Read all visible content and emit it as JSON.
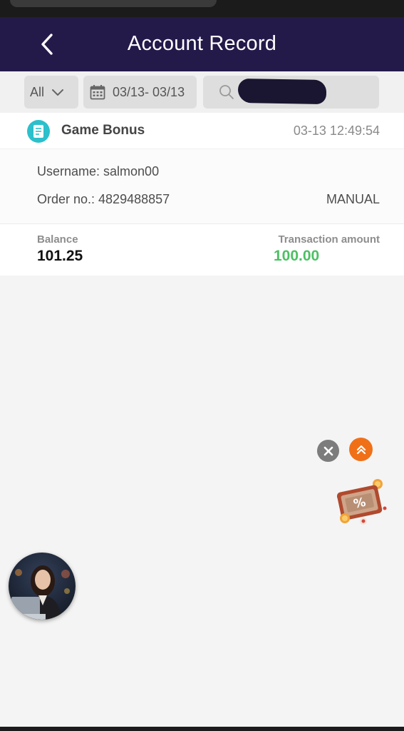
{
  "header": {
    "title": "Account Record",
    "back_icon": "chevron-left-icon"
  },
  "filters": {
    "type_value": "All",
    "date_range": "03/13- 03/13",
    "search_value": ""
  },
  "record": {
    "title": "Game Bonus",
    "datetime": "03-13 12:49:54",
    "username_line": "Username: salmon00",
    "order_line": "Order no.: 4829488857",
    "method": "MANUAL",
    "balance_label": "Balance",
    "balance_value": "101.25",
    "amount_label": "Transaction amount",
    "amount_value": "100.00"
  },
  "colors": {
    "header_bg": "#241a4a",
    "amount_green": "#4cc063",
    "accent_orange": "#f07018",
    "icon_teal": "#2bc0cc"
  }
}
